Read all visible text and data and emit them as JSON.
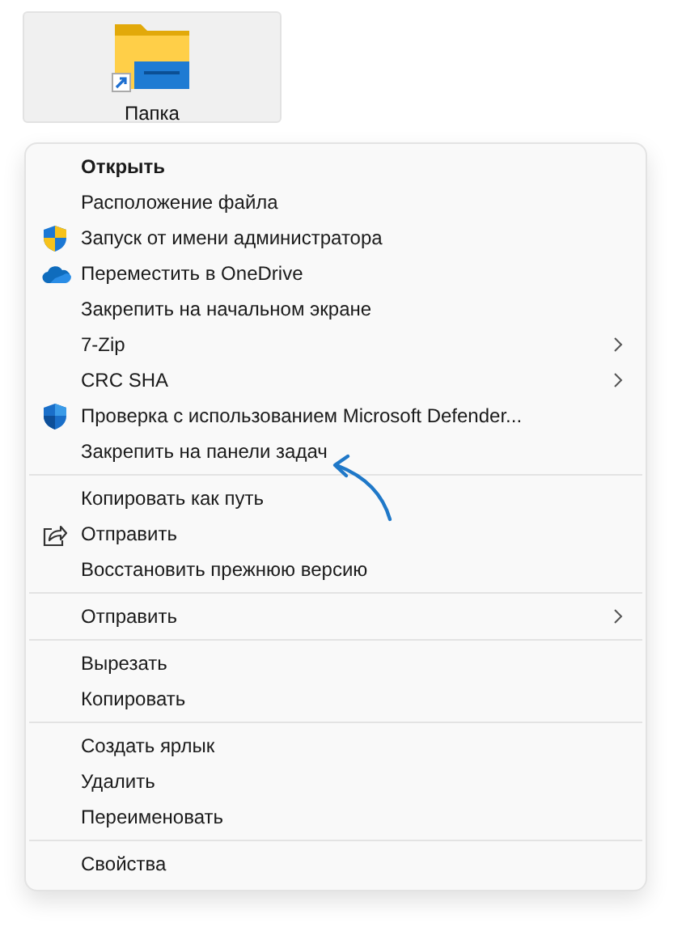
{
  "folder": {
    "label": "Папка",
    "shortcut": true
  },
  "menu": {
    "groups": [
      [
        {
          "label": "Открыть",
          "kind": "plain",
          "default": true,
          "submenu": false
        },
        {
          "label": "Расположение файла",
          "kind": "plain",
          "default": false,
          "submenu": false
        },
        {
          "label": "Запуск от имени администратора",
          "kind": "admin",
          "default": false,
          "submenu": false
        },
        {
          "label": "Переместить в OneDrive",
          "kind": "onedrive",
          "default": false,
          "submenu": false
        },
        {
          "label": "Закрепить на начальном экране",
          "kind": "plain",
          "default": false,
          "submenu": false
        },
        {
          "label": "7-Zip",
          "kind": "plain",
          "default": false,
          "submenu": true
        },
        {
          "label": "CRC SHA",
          "kind": "plain",
          "default": false,
          "submenu": true
        },
        {
          "label": "Проверка с использованием Microsoft Defender...",
          "kind": "defender",
          "default": false,
          "submenu": false
        },
        {
          "label": "Закрепить на панели задач",
          "kind": "plain",
          "default": false,
          "submenu": false,
          "annotated": true
        }
      ],
      [
        {
          "label": "Копировать как путь",
          "kind": "plain",
          "default": false,
          "submenu": false
        },
        {
          "label": "Отправить",
          "kind": "share",
          "default": false,
          "submenu": false
        },
        {
          "label": "Восстановить прежнюю версию",
          "kind": "plain",
          "default": false,
          "submenu": false
        }
      ],
      [
        {
          "label": "Отправить",
          "kind": "plain",
          "default": false,
          "submenu": true
        }
      ],
      [
        {
          "label": "Вырезать",
          "kind": "plain",
          "default": false,
          "submenu": false
        },
        {
          "label": "Копировать",
          "kind": "plain",
          "default": false,
          "submenu": false
        }
      ],
      [
        {
          "label": "Создать ярлык",
          "kind": "plain",
          "default": false,
          "submenu": false
        },
        {
          "label": "Удалить",
          "kind": "plain",
          "default": false,
          "submenu": false
        },
        {
          "label": "Переименовать",
          "kind": "plain",
          "default": false,
          "submenu": false
        }
      ],
      [
        {
          "label": "Свойства",
          "kind": "plain",
          "default": false,
          "submenu": false
        }
      ]
    ]
  }
}
